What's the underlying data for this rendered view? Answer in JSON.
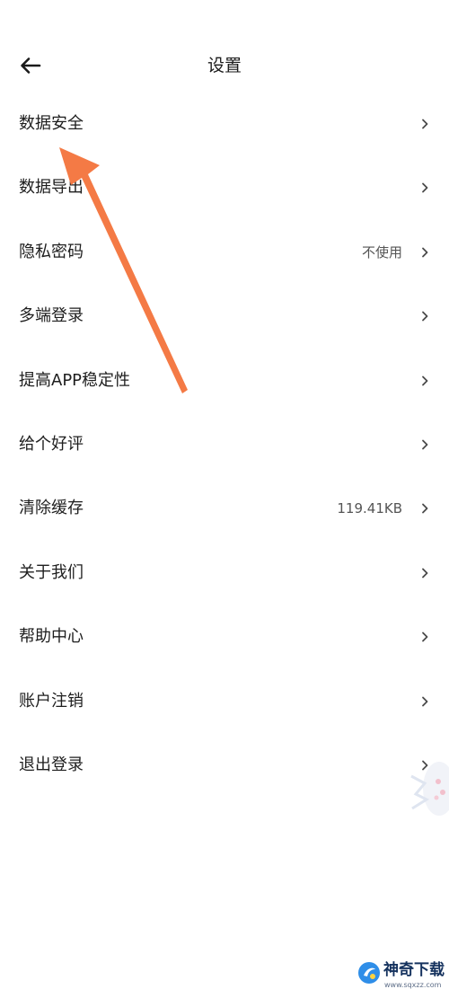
{
  "header": {
    "title": "设置",
    "back_icon": "arrow-left-icon"
  },
  "settings": [
    {
      "label": "数据安全",
      "value": ""
    },
    {
      "label": "数据导出",
      "value": ""
    },
    {
      "label": "隐私密码",
      "value": "不使用"
    },
    {
      "label": "多端登录",
      "value": ""
    },
    {
      "label": "提高APP稳定性",
      "value": ""
    },
    {
      "label": "给个好评",
      "value": ""
    },
    {
      "label": "清除缓存",
      "value": "119.41KB"
    },
    {
      "label": "关于我们",
      "value": ""
    },
    {
      "label": "帮助中心",
      "value": ""
    },
    {
      "label": "账户注销",
      "value": ""
    },
    {
      "label": "退出登录",
      "value": ""
    }
  ],
  "annotation": {
    "arrow_color": "#f47a45",
    "arrow_icon": "pointer-arrow-icon"
  },
  "watermark": {
    "name": "神奇下载",
    "url": "www.sqxzz.com",
    "logo_icon": "sqxz-logo-icon"
  }
}
